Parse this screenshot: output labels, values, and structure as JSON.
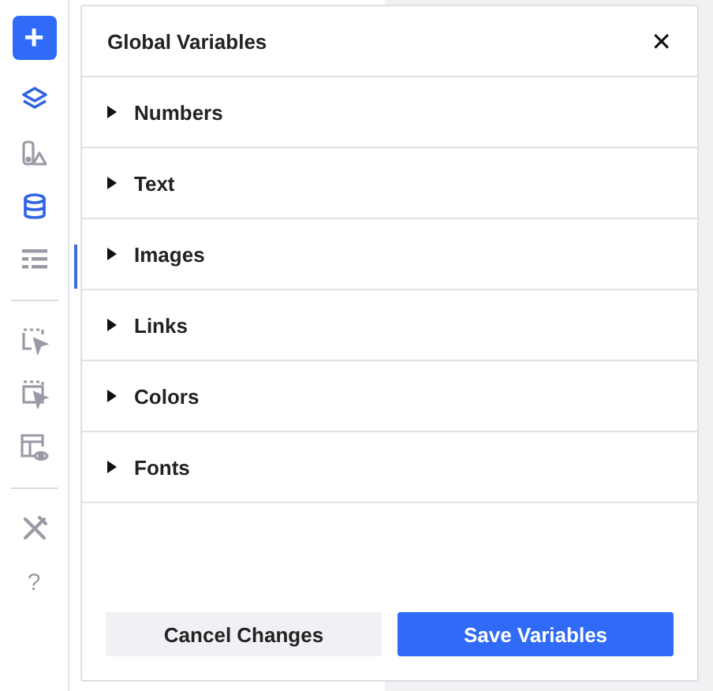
{
  "sidebar": {
    "add_button": "+",
    "tool_groups": [
      [
        {
          "kind": "layers",
          "active": true
        },
        {
          "kind": "shapes",
          "active": false
        },
        {
          "kind": "database",
          "active": true
        },
        {
          "kind": "list",
          "active": false
        }
      ],
      [
        {
          "kind": "select",
          "active": false
        },
        {
          "kind": "select-multi",
          "active": false
        },
        {
          "kind": "preview",
          "active": false
        }
      ],
      [
        {
          "kind": "tools",
          "active": false
        },
        {
          "kind": "help",
          "active": false,
          "label": "?"
        }
      ]
    ]
  },
  "dialog": {
    "title": "Global Variables",
    "close": "✕",
    "sections": [
      {
        "label": "Numbers",
        "expanded": false
      },
      {
        "label": "Text",
        "expanded": false
      },
      {
        "label": "Images",
        "expanded": false
      },
      {
        "label": "Links",
        "expanded": false
      },
      {
        "label": "Colors",
        "expanded": false
      },
      {
        "label": "Fonts",
        "expanded": false
      }
    ],
    "buttons": [
      {
        "label": "Cancel Changes",
        "kind": "secondary"
      },
      {
        "label": "Save Variables",
        "kind": "primary"
      }
    ]
  }
}
